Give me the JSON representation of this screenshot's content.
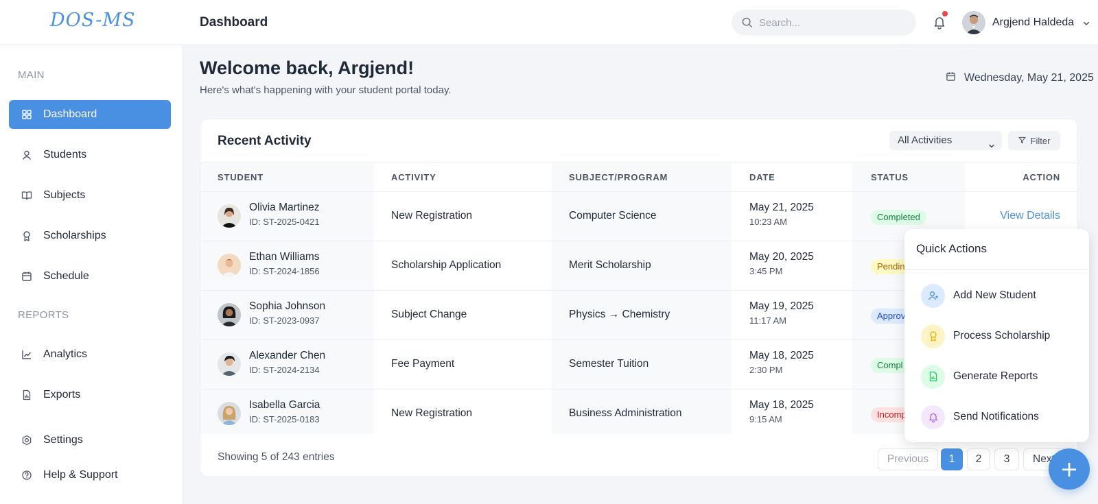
{
  "header": {
    "logo": "DOS-MS",
    "title": "Dashboard",
    "search_placeholder": "Search...",
    "user_name": "Argjend Haldeda"
  },
  "sidebar": {
    "main_label": "MAIN",
    "reports_label": "REPORTS",
    "items": [
      {
        "label": "Dashboard",
        "icon": "grid-icon"
      },
      {
        "label": "Students",
        "icon": "user-icon"
      },
      {
        "label": "Subjects",
        "icon": "book-icon"
      },
      {
        "label": "Scholarships",
        "icon": "award-icon"
      },
      {
        "label": "Schedule",
        "icon": "calendar-icon"
      },
      {
        "label": "Analytics",
        "icon": "chart-line-icon"
      },
      {
        "label": "Exports",
        "icon": "file-icon"
      },
      {
        "label": "Settings",
        "icon": "gear-icon"
      },
      {
        "label": "Help & Support",
        "icon": "help-icon"
      }
    ]
  },
  "main": {
    "welcome_title": "Welcome back, Argjend!",
    "welcome_sub": "Here's what's happening with your student portal today.",
    "date": "Wednesday, May 21, 2025"
  },
  "activity": {
    "title": "Recent Activity",
    "filter_select": "All Activities",
    "filter_button": "Filter",
    "columns": [
      "STUDENT",
      "ACTIVITY",
      "SUBJECT/PROGRAM",
      "DATE",
      "STATUS",
      "ACTION"
    ],
    "rows": [
      {
        "name": "Olivia Martinez",
        "id": "ID: ST-2025-0421",
        "activity": "New Registration",
        "subject": "Computer Science",
        "date": "May 21, 2025",
        "time": "10:23 AM",
        "status": "Completed",
        "action": "View Details"
      },
      {
        "name": "Ethan Williams",
        "id": "ID: ST-2024-1856",
        "activity": "Scholarship Application",
        "subject": "Merit Scholarship",
        "date": "May 20, 2025",
        "time": "3:45 PM",
        "status": "Pendin",
        "action": ""
      },
      {
        "name": "Sophia Johnson",
        "id": "ID: ST-2023-0937",
        "activity": "Subject Change",
        "subject": "Physics → Chemistry",
        "date": "May 19, 2025",
        "time": "11:17 AM",
        "status": "Approv",
        "action": ""
      },
      {
        "name": "Alexander Chen",
        "id": "ID: ST-2024-2134",
        "activity": "Fee Payment",
        "subject": "Semester Tuition",
        "date": "May 18, 2025",
        "time": "2:30 PM",
        "status": "Compl",
        "action": ""
      },
      {
        "name": "Isabella Garcia",
        "id": "ID: ST-2025-0183",
        "activity": "New Registration",
        "subject": "Business Administration",
        "date": "May 18, 2025",
        "time": "9:15 AM",
        "status": "Incomp",
        "action": ""
      }
    ],
    "showing": "Showing 5 of 243 entries",
    "pagination": {
      "previous": "Previous",
      "pages": [
        "1",
        "2",
        "3"
      ],
      "next": "Next"
    }
  },
  "quick_actions": {
    "title": "Quick Actions",
    "items": [
      {
        "label": "Add New Student",
        "icon": "user-plus-icon",
        "color": "#4a90e2"
      },
      {
        "label": "Process Scholarship",
        "icon": "award-icon",
        "color": "#eab308"
      },
      {
        "label": "Generate Reports",
        "icon": "report-icon",
        "color": "#22c55e"
      },
      {
        "label": "Send Notifications",
        "icon": "bell-icon",
        "color": "#a855f7"
      }
    ]
  },
  "fab_label": "+",
  "colors": {
    "accent": "#4a90e2",
    "notification_dot": "#ef4444"
  }
}
